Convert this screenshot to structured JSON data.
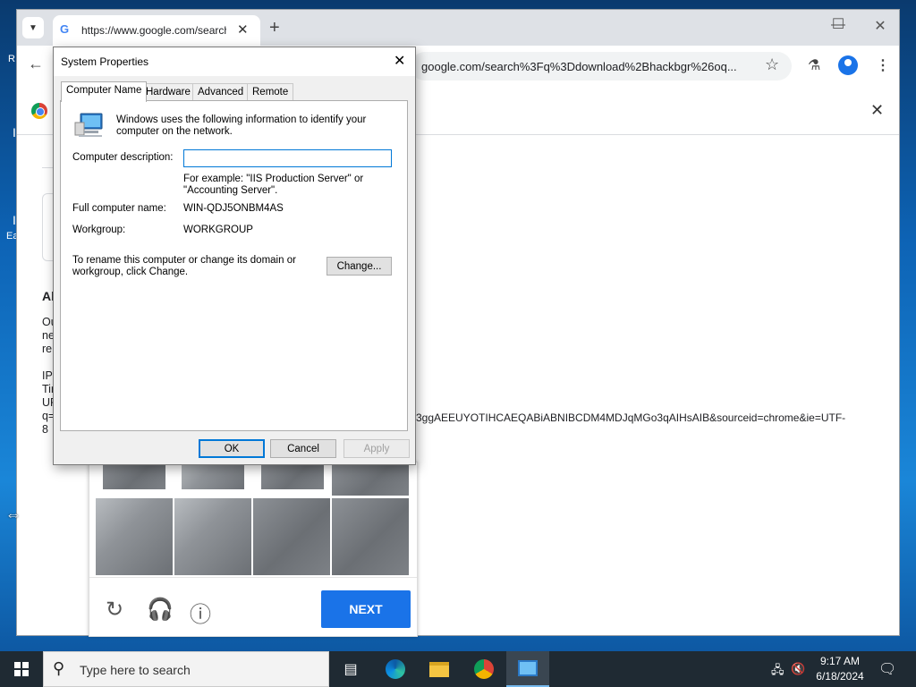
{
  "desktop": {
    "fragments": [
      "R",
      "I",
      "I",
      "Ea"
    ]
  },
  "browser": {
    "tab_title": "https://www.google.com/search",
    "new_tab_label": "+",
    "url": "google.com/search%3Fq%3Ddownload%2Bhackbgr%26oq..."
  },
  "page": {
    "about_heading": "Ab",
    "para_lines": [
      "Ou",
      "ne",
      "re"
    ],
    "info_lines": [
      "IP",
      "Tir",
      "UF",
      "q=",
      "8"
    ],
    "long_url_tail": "3ggAEEUYOTIHCAEQABiABNIBCDM4MDJqMGo3qAIHsAIB&sourceid=chrome&ie=UTF-",
    "next_label": "NEXT"
  },
  "dialog": {
    "title": "System Properties",
    "tabs": [
      "Computer Name",
      "Hardware",
      "Advanced",
      "Remote"
    ],
    "intro_text": "Windows uses the following information to identify your computer on the network.",
    "desc_label": "Computer description:",
    "desc_value": "",
    "example_line1": "For example: \"IIS Production Server\" or",
    "example_line2": "\"Accounting Server\".",
    "full_name_label": "Full computer name:",
    "full_name_value": "WIN-QDJ5ONBM4AS",
    "workgroup_label": "Workgroup:",
    "workgroup_value": "WORKGROUP",
    "rename_line1": "To rename this computer or change its domain or",
    "rename_line2": "workgroup, click Change.",
    "change_label": "Change...",
    "ok_label": "OK",
    "cancel_label": "Cancel",
    "apply_label": "Apply"
  },
  "taskbar": {
    "search_placeholder": "Type here to search",
    "time": "9:17 AM",
    "date": "6/18/2024"
  },
  "colors": {
    "accent": "#1a73e8",
    "win_accent": "#0078d7"
  },
  "icons": [
    "chevron-down-icon",
    "google-g-icon",
    "close-icon",
    "plus-icon",
    "minimize-icon",
    "maximize-icon",
    "back-icon",
    "star-icon",
    "labs-icon",
    "profile-icon",
    "menu-icon",
    "chrome-icon",
    "reload-icon",
    "headphones-icon",
    "info-icon",
    "computer-icon",
    "windows-start-icon",
    "search-icon",
    "task-view-icon",
    "edge-icon",
    "file-explorer-icon",
    "system-icon",
    "network-icon",
    "volume-muted-icon",
    "notification-icon",
    "resize-cursor-icon"
  ]
}
